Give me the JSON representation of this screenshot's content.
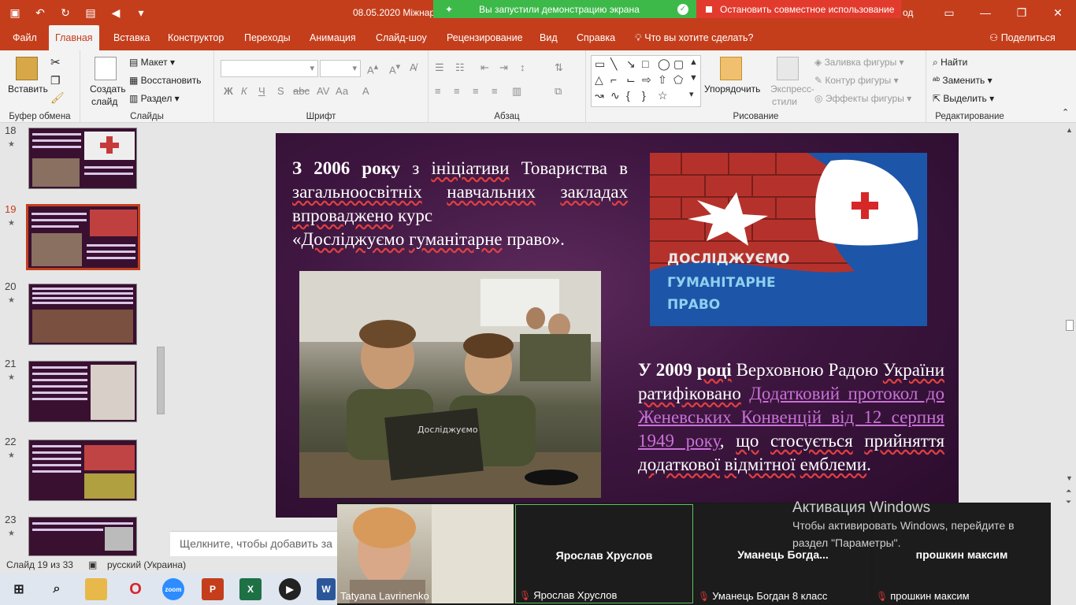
{
  "window": {
    "doc_title": "08.05.2020 Міжнарод",
    "title_right": "од",
    "share_banner": "Вы запустили демонстрацию экрана",
    "stop_share": "Остановить совместное использование"
  },
  "tabs": [
    "Файл",
    "Главная",
    "Вставка",
    "Конструктор",
    "Переходы",
    "Анимация",
    "Слайд-шоу",
    "Рецензирование",
    "Вид",
    "Справка"
  ],
  "tell_me": "Что вы хотите сделать?",
  "share_label": "Поделиться",
  "ribbon": {
    "clipboard": {
      "paste": "Вставить",
      "label": "Буфер обмена"
    },
    "slides": {
      "new_slide_1": "Создать",
      "new_slide_2": "слайд",
      "layout": "Макет",
      "reset": "Восстановить",
      "section": "Раздел",
      "label": "Слайды"
    },
    "font": {
      "label": "Шрифт",
      "bold": "Ж",
      "italic": "К",
      "underline": "Ч",
      "strike": "S",
      "case": "Аа"
    },
    "paragraph": {
      "label": "Абзац"
    },
    "drawing": {
      "arrange_1": "Упорядочить",
      "quick_styles_1": "Экспресс-",
      "quick_styles_2": "стили",
      "fill": "Заливка фигуры",
      "outline": "Контур фигуры",
      "effects": "Эффекты фигуры",
      "label": "Рисование"
    },
    "editing": {
      "find": "Найти",
      "replace": "Заменить",
      "select": "Выделить",
      "label": "Редактирование"
    }
  },
  "thumbnails": [
    {
      "number": "18",
      "active": false
    },
    {
      "number": "19",
      "active": true
    },
    {
      "number": "20",
      "active": false
    },
    {
      "number": "21",
      "active": false
    },
    {
      "number": "22",
      "active": false
    },
    {
      "number": "23",
      "active": false
    }
  ],
  "slide": {
    "para1_bold": "З 2006 року",
    "para1_a": " з ",
    "para1_b": "ініціативи",
    "para1_c": " Товариства в ",
    "para1_d": "загальноосвітніх",
    "para1_e": " ",
    "para1_f": "навчальних",
    "para1_g": " ",
    "para1_h": "закладах",
    "para1_i": " ",
    "para1_j": "впроваджено",
    "para1_k": " курс",
    "para1_l": "«",
    "para1_m": "Досліджуємо",
    "para1_n": " ",
    "para1_o": "гуманітарне",
    "para1_p": " право».",
    "para2_bold1": "У 2009",
    "para2_bold2": "році",
    "para2_a": " Верховною Радою ",
    "para2_b": "України",
    "para2_c": " ",
    "para2_d": "ратифіковано",
    "para2_link": "Додатковий протокол до Женевських Конвенцій від 12 серпня 1949 року",
    "para2_e": ", ",
    "para2_f": "що",
    "para2_g": " ",
    "para2_h": "стосується",
    "para2_i": " ",
    "para2_j": "прийняття",
    "para2_k": " ",
    "para2_l": "додаткової",
    "para2_m": " ",
    "para2_n": "відмітної",
    "para2_o": " ",
    "para2_p": "емблеми",
    "para2_q": ".",
    "emblem_line1": "ДОСЛІДЖУЄМО",
    "emblem_line2": "ГУМАНІТАРНЕ",
    "emblem_line3": "ПРАВО",
    "book_label": "Досліджуємо"
  },
  "notes_placeholder": "Щелкните, чтобы добавить за",
  "status": {
    "slide_counter": "Слайд 19 из 33",
    "language": "русский (Украина)"
  },
  "zoom": {
    "tiles": [
      {
        "center": "",
        "bottom": "Tatyana Lavrinenko",
        "muted": false
      },
      {
        "center": "Ярослав Хруслов",
        "bottom": "Ярослав Хруслов",
        "muted": true
      },
      {
        "center": "Уманець  Богда...",
        "bottom": "Уманець Богдан 8 класс",
        "muted": true
      },
      {
        "center": "прошкин максим",
        "bottom": "прошкин максим",
        "muted": true
      }
    ]
  },
  "activation": {
    "title": "Активация Windows",
    "body": "Чтобы активировать Windows, перейдите в раздел \"Параметры\"."
  },
  "taskbar": {
    "zoom_label": "zoom",
    "colors": {
      "accent": "#c43e1c",
      "share_green": "#3db94a",
      "stop_red": "#e23b2e"
    }
  }
}
